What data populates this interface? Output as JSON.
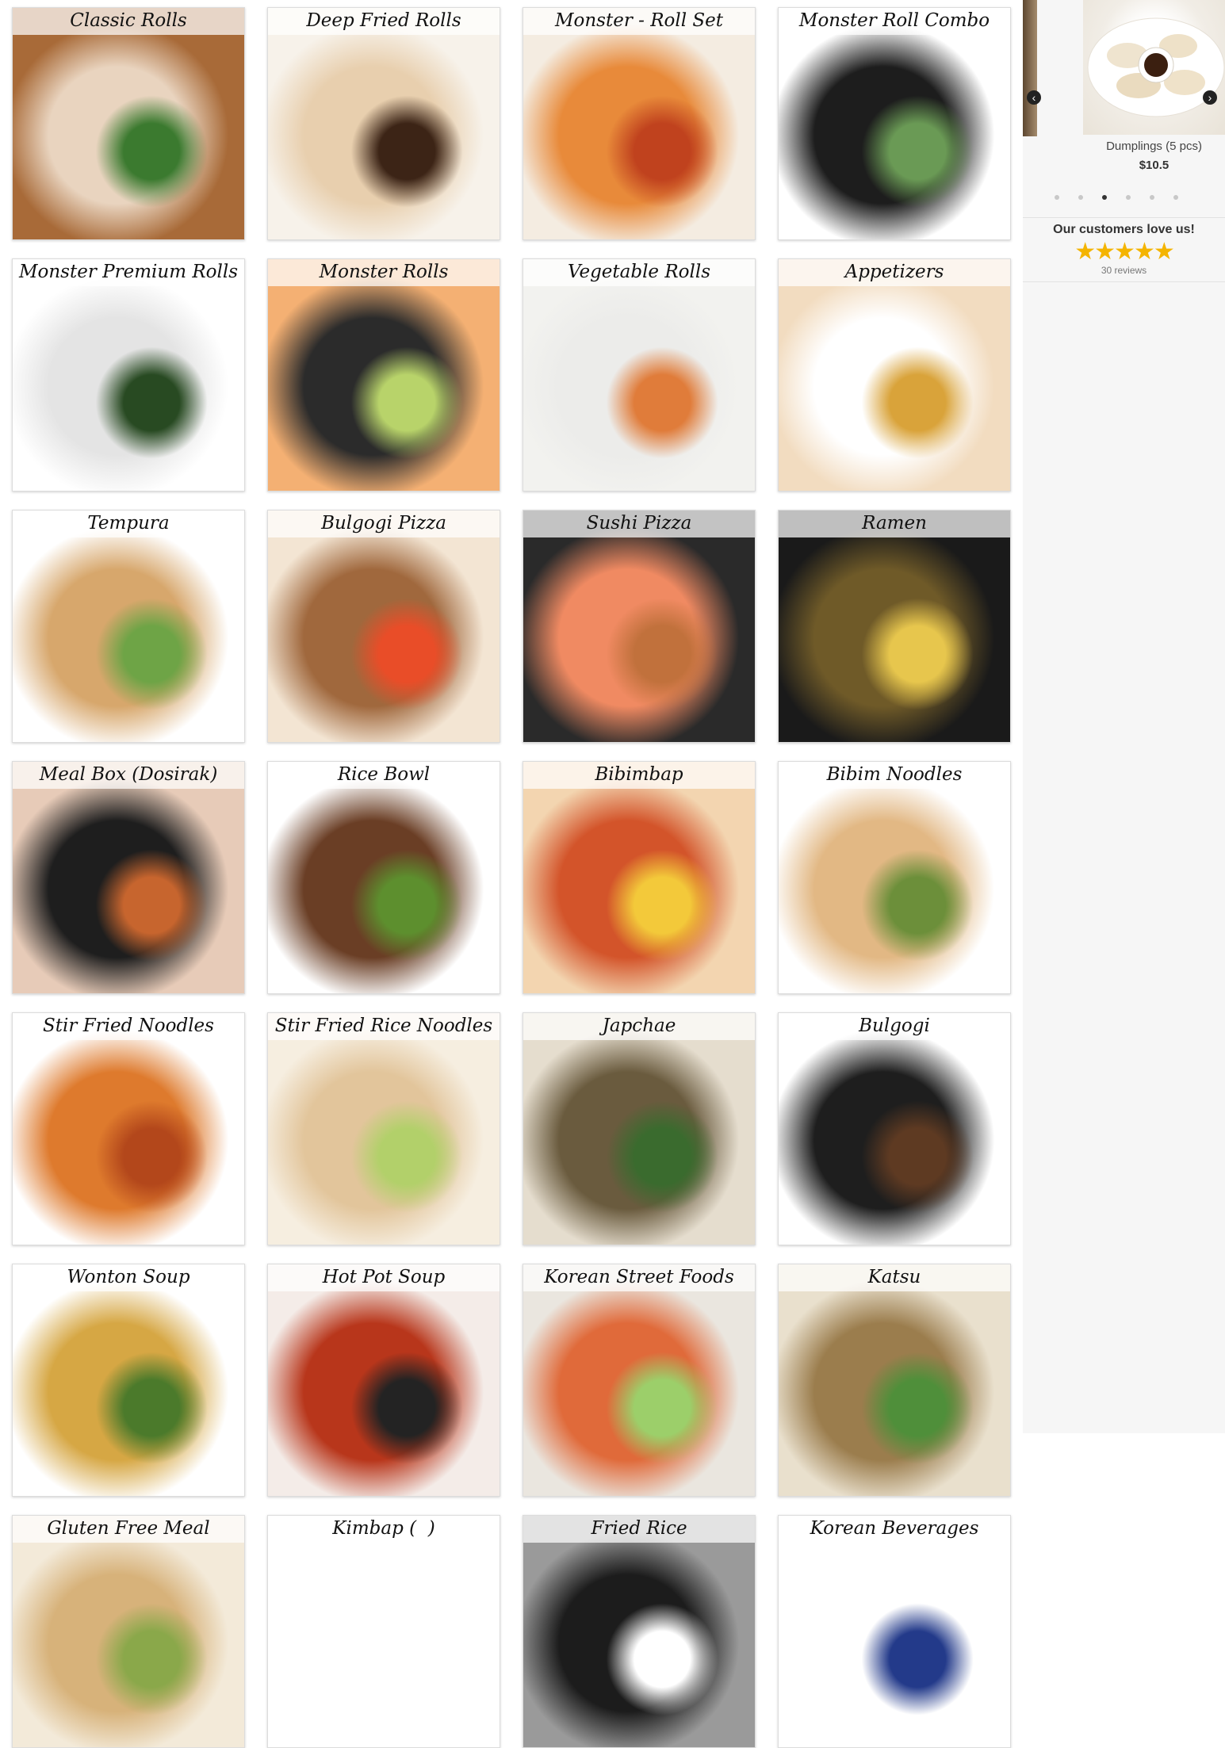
{
  "menu": {
    "categories": [
      {
        "name": "Classic Rolls",
        "colors": [
          "#a86a38",
          "#e9d4bf",
          "#3b7a2f"
        ]
      },
      {
        "name": "Deep Fried Rolls",
        "colors": [
          "#f7f2ea",
          "#e8cfae",
          "#3c2416"
        ]
      },
      {
        "name": "Monster - Roll Set",
        "colors": [
          "#f4ece1",
          "#e88a3a",
          "#c0421e"
        ]
      },
      {
        "name": "Monster Roll Combo",
        "colors": [
          "#ffffff",
          "#1d1d1d",
          "#6a9a55"
        ]
      },
      {
        "name": "Monster Premium Rolls",
        "colors": [
          "#ffffff",
          "#e4e4e4",
          "#284a22"
        ]
      },
      {
        "name": "Monster Rolls",
        "colors": [
          "#f4b073",
          "#2b2b2b",
          "#b8d36a"
        ]
      },
      {
        "name": "Vegetable Rolls",
        "colors": [
          "#f2f2ef",
          "#ececea",
          "#e07c3a"
        ]
      },
      {
        "name": "Appetizers",
        "colors": [
          "#f2dcc0",
          "#ffffff",
          "#d9a33a"
        ]
      },
      {
        "name": "Tempura",
        "colors": [
          "#ffffff",
          "#d7a76c",
          "#6ea446"
        ]
      },
      {
        "name": "Bulgogi Pizza",
        "colors": [
          "#f3e5d3",
          "#a0683d",
          "#e94d28"
        ]
      },
      {
        "name": "Sushi Pizza",
        "colors": [
          "#2a2a2a",
          "#f08a62",
          "#c1713c"
        ]
      },
      {
        "name": "Ramen",
        "colors": [
          "#1a1a1a",
          "#6f5a28",
          "#e7c64d"
        ]
      },
      {
        "name": "Meal Box (Dosirak)",
        "colors": [
          "#e7cbb8",
          "#1e1e1e",
          "#c7652e"
        ]
      },
      {
        "name": "Rice Bowl",
        "colors": [
          "#ffffff",
          "#6a3e25",
          "#5d8f2e"
        ]
      },
      {
        "name": "Bibimbap",
        "colors": [
          "#f3d5b0",
          "#d3542a",
          "#f3c93a"
        ]
      },
      {
        "name": "Bibim Noodles",
        "colors": [
          "#ffffff",
          "#e2b884",
          "#6c8f3a"
        ]
      },
      {
        "name": "Stir Fried Noodles",
        "colors": [
          "#ffffff",
          "#de7a2d",
          "#b3471b"
        ]
      },
      {
        "name": "Stir Fried Rice Noodles",
        "colors": [
          "#f6eee0",
          "#e2c59b",
          "#b2d06a"
        ]
      },
      {
        "name": "Japchae",
        "colors": [
          "#e5ddce",
          "#6a5b3e",
          "#3a6b2e"
        ]
      },
      {
        "name": "Bulgogi",
        "colors": [
          "#ffffff",
          "#1e1e1e",
          "#5e3a22"
        ]
      },
      {
        "name": "Wonton Soup",
        "colors": [
          "#ffffff",
          "#d6a744",
          "#4b7a2b"
        ]
      },
      {
        "name": "Hot Pot Soup",
        "colors": [
          "#f4ece8",
          "#b8361b",
          "#232323"
        ]
      },
      {
        "name": "Korean Street Foods",
        "colors": [
          "#eae6df",
          "#e06a3a",
          "#9ccf6a"
        ]
      },
      {
        "name": "Katsu",
        "colors": [
          "#e9e0cd",
          "#9b7d4d",
          "#4f8f3a"
        ]
      },
      {
        "name": "Gluten Free Meal",
        "colors": [
          "#f3ead9",
          "#d7b27a",
          "#8aa84a"
        ]
      },
      {
        "name": "Kimbap (  )",
        "colors": [
          "#ffffff",
          "#ffffff",
          "#ffffff"
        ]
      },
      {
        "name": "Fried Rice",
        "colors": [
          "#9a9a9a",
          "#1c1c1c",
          "#ffffff"
        ]
      },
      {
        "name": "Korean Beverages",
        "colors": [
          "#ffffff",
          "#ffffff",
          "#233a8a"
        ]
      }
    ]
  },
  "sidebar": {
    "carousel": {
      "item_name": "Dumplings (5 pcs)",
      "item_price": "$10.5",
      "prev_icon": "chevron-left-icon",
      "next_icon": "chevron-right-icon",
      "slide_count": 6,
      "active_slide": 3
    },
    "reviews": {
      "title": "Our customers love us!",
      "rating": 5,
      "star_color": "#f4b400",
      "count_label": "30 reviews"
    }
  }
}
